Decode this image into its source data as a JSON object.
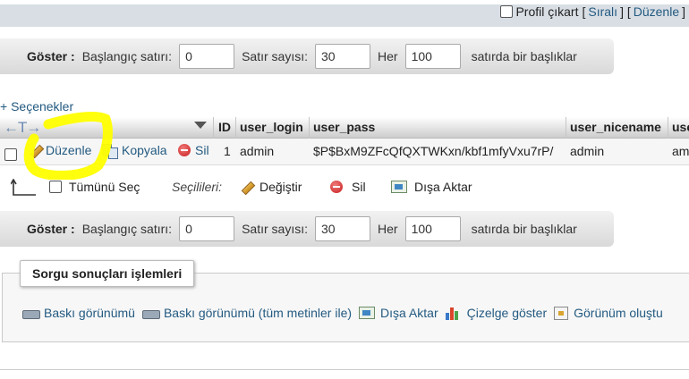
{
  "topbar": {
    "profiling_label": "Profil çıkart",
    "inline_label": "Sıralı",
    "edit_label": "Düzenle",
    "bracket_open": "[",
    "bracket_mid": "] [",
    "bracket_close": "]"
  },
  "nav": {
    "show_label": "Göster :",
    "start_row_label": "Başlangıç satırı:",
    "start_row_value": "0",
    "row_count_label": "Satır sayısı:",
    "row_count_value": "30",
    "every_label": "Her",
    "every_value": "100",
    "headers_suffix": "satırda bir başlıklar"
  },
  "options_link": "+ Seçenekler",
  "table": {
    "columns": [
      "ID",
      "user_login",
      "user_pass",
      "user_nicename",
      "use"
    ],
    "arrows": "←T→",
    "row": {
      "edit": "Düzenle",
      "copy": "Kopyala",
      "delete": "Sil",
      "id": "1",
      "user_login": "admin",
      "user_pass": "$P$BxM9ZFcQfQXTWKxn/kbf1mfyVxu7rP/",
      "user_nicename": "admin",
      "user_email": "am"
    }
  },
  "bulk": {
    "select_all": "Tümünü Seç",
    "with_selected": "Seçilileri:",
    "change": "Değiştir",
    "delete": "Sil",
    "export": "Dışa Aktar"
  },
  "query_ops": {
    "legend": "Sorgu sonuçları işlemleri",
    "print_view": "Baskı görünümü",
    "print_view_full": "Baskı görünümü (tüm metinler ile)",
    "export": "Dışa Aktar",
    "display_chart": "Çizelge göster",
    "create_view": "Görünüm oluştu"
  },
  "colors": {
    "link": "#235a81",
    "highlight": "#ffff00"
  }
}
